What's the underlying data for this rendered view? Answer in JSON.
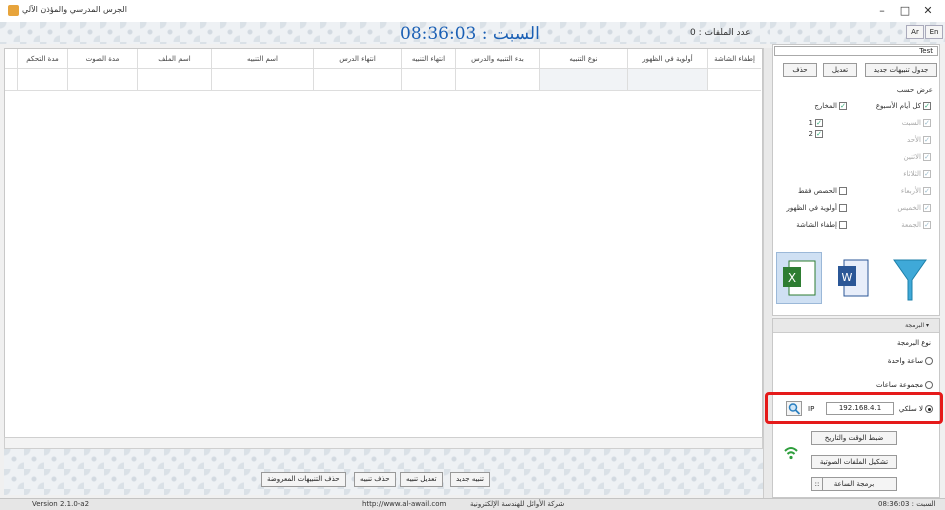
{
  "window": {
    "title": "الجرس المدرسي والمؤذن الآلي",
    "minimize": "–",
    "maximize": "□",
    "close": "✕"
  },
  "header": {
    "clock": "السبت : 08:36:03",
    "files_count": "عدد الملفات : 0",
    "lang_ar": "Ar",
    "lang_en": "En"
  },
  "table": {
    "columns": [
      "إطفاء الشاشة",
      "أولوية في الظهور",
      "نوع التنبيه",
      "بدء التنبيه والدرس",
      "انتهاء التنبيه",
      "انتهاء الدرس",
      "اسم التنبيه",
      "اسم الملف",
      "مدة الصوت",
      "مدة التحكم"
    ]
  },
  "bottom_buttons": {
    "new_alert": "تنبيه جديد",
    "edit_alert": "تعديل تنبيه",
    "delete_alert": "حذف تنبيه",
    "delete_shown": "حذف التنبيهات المعروضة"
  },
  "status": {
    "version": "Version 2.1.0-a2",
    "url": "http://www.al-awail.com",
    "company": "شركة الأوائل للهندسة الإلكترونية",
    "time": "السبت : 08:36:03"
  },
  "right_panel": {
    "combo_value": "Test",
    "new_table": "جدول تنبيهات جديد",
    "edit": "تعديل",
    "delete": "حذف",
    "view_by": "عرض حسب",
    "all_week": "كل أيام الأسبوع",
    "outputs": "المخارج",
    "days": [
      "السبت",
      "الأحد",
      "الاثنين",
      "الثلاثاء",
      "الأربعاء",
      "الخميس",
      "الجمعة"
    ],
    "out1": "1",
    "out2": "2",
    "classes_only": "الحصص فقط",
    "priority": "أولوية في الظهور",
    "screen_off": "إطفاء الشاشة"
  },
  "programming": {
    "head": "البرمجة",
    "type_label": "نوع البرمجة",
    "single_clock": "ساعة واحدة",
    "group_clocks": "مجموعة ساعات",
    "wireless": "لا سلكي",
    "ip_label": "IP",
    "ip_value": "192.168.4.1",
    "set_datetime": "ضبط الوقت والتاريخ",
    "format_audio": "تشكيل الملفات الصوتية",
    "program_clock": "برمجة الساعة"
  }
}
